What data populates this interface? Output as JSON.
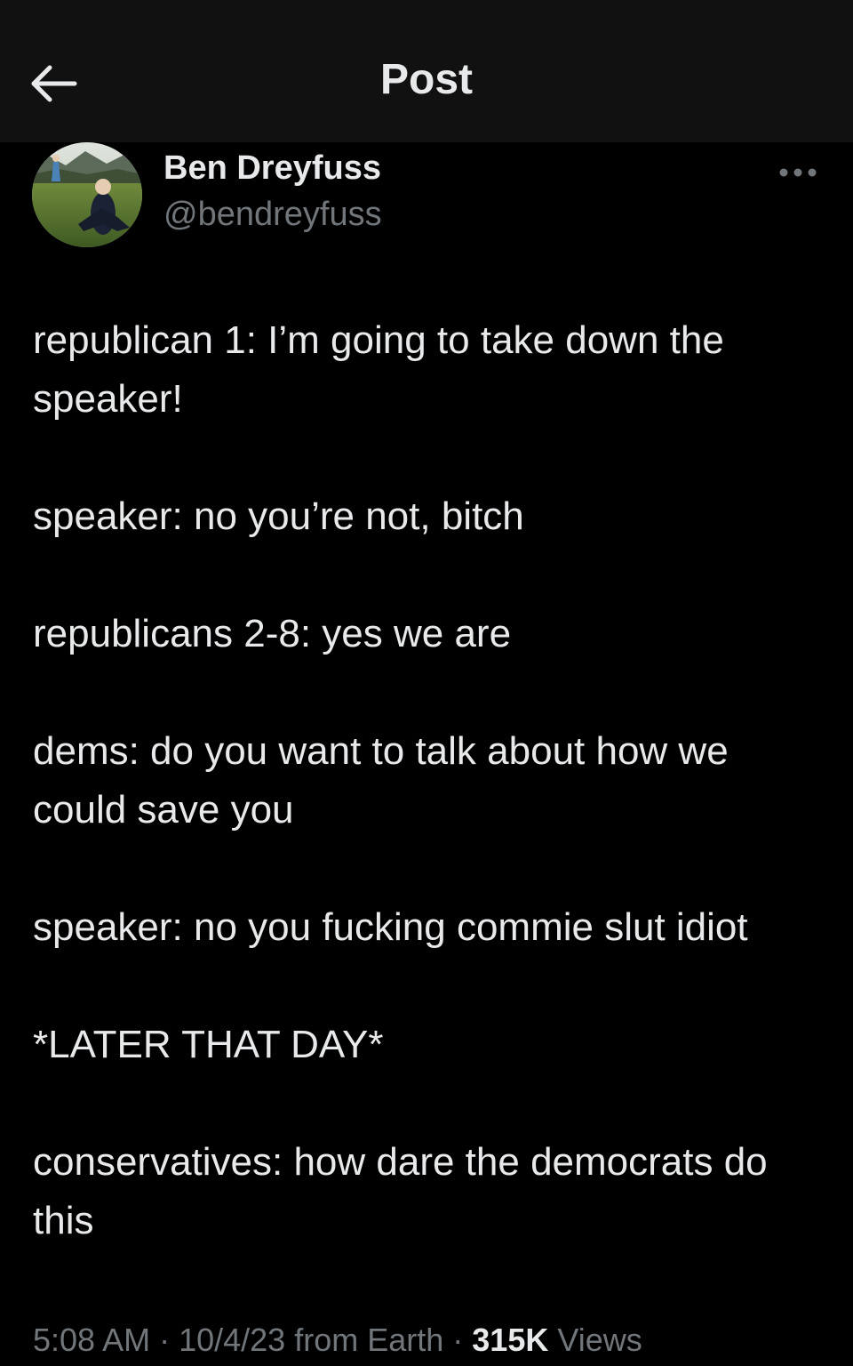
{
  "header": {
    "title": "Post",
    "back_icon": "arrow-left-icon"
  },
  "author": {
    "name": "Ben Dreyfuss",
    "handle": "@bendreyfuss",
    "avatar_icon": "avatar-photo",
    "more_icon": "more-horizontal-icon"
  },
  "post": {
    "paragraphs": [
      "republican 1: I’m going to take down the speaker!",
      "speaker: no you’re not, bitch",
      "republicans 2-8: yes we are",
      "dems: do you want to talk about how we could save you",
      "speaker: no you fucking commie slut idiot",
      "*LATER THAT DAY*",
      "conservatives: how dare the democrats do this"
    ]
  },
  "meta": {
    "time": "5:08 AM",
    "sep1": " · ",
    "date": "10/4/23",
    "location": " from Earth",
    "sep2": " · ",
    "views_count": "315K",
    "views_label": " Views"
  },
  "colors": {
    "background": "#000000",
    "header_background": "#111111",
    "primary_text": "#e7e9ea",
    "secondary_text": "#71767b"
  }
}
